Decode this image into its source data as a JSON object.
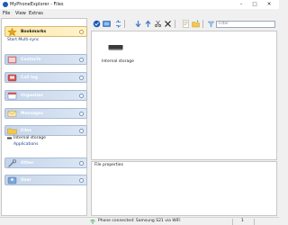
{
  "window": {
    "title": "MyPhoneExplorer - Files",
    "minimize_glyph": "–",
    "maximize_glyph": "□",
    "close_glyph": "✕"
  },
  "menu": [
    "File",
    "View",
    "Extras"
  ],
  "sidebar": {
    "groups": [
      {
        "label": "Bookmarks",
        "icon": "star-icon",
        "active": true
      },
      {
        "label": "Contacts",
        "icon": "contacts-book-icon"
      },
      {
        "label": "Call log",
        "icon": "phone-icon"
      },
      {
        "label": "Organizer",
        "icon": "organizer-icon"
      },
      {
        "label": "Messages",
        "icon": "envelope-icon"
      },
      {
        "label": "Files",
        "icon": "folder-icon"
      },
      {
        "label": "Other",
        "icon": "wrench-icon"
      },
      {
        "label": "User",
        "icon": "user-icon"
      }
    ],
    "bookmarks_items": [
      "Start Multi-sync"
    ],
    "files_items": [
      "Internal storage",
      "Applications"
    ]
  },
  "toolbar": {
    "filter_placeholder": "Filter",
    "icons": [
      "connect-icon",
      "refresh-icon",
      "view-mode-icon",
      "download-icon",
      "upload-icon",
      "cut-icon",
      "delete-icon",
      "rename-icon",
      "new-folder-icon",
      "search-icon"
    ]
  },
  "content": {
    "items": [
      {
        "label": "Internal storage",
        "icon": "drive-icon"
      }
    ]
  },
  "properties": {
    "title": "File properties"
  },
  "statusbar": {
    "text": "Phone connected: Samsung S21 via WiFi",
    "count": "1"
  },
  "colors": {
    "accent": "#1c5bb8",
    "active_group": "#fde9a8",
    "group_header": "#c5d5ea"
  }
}
